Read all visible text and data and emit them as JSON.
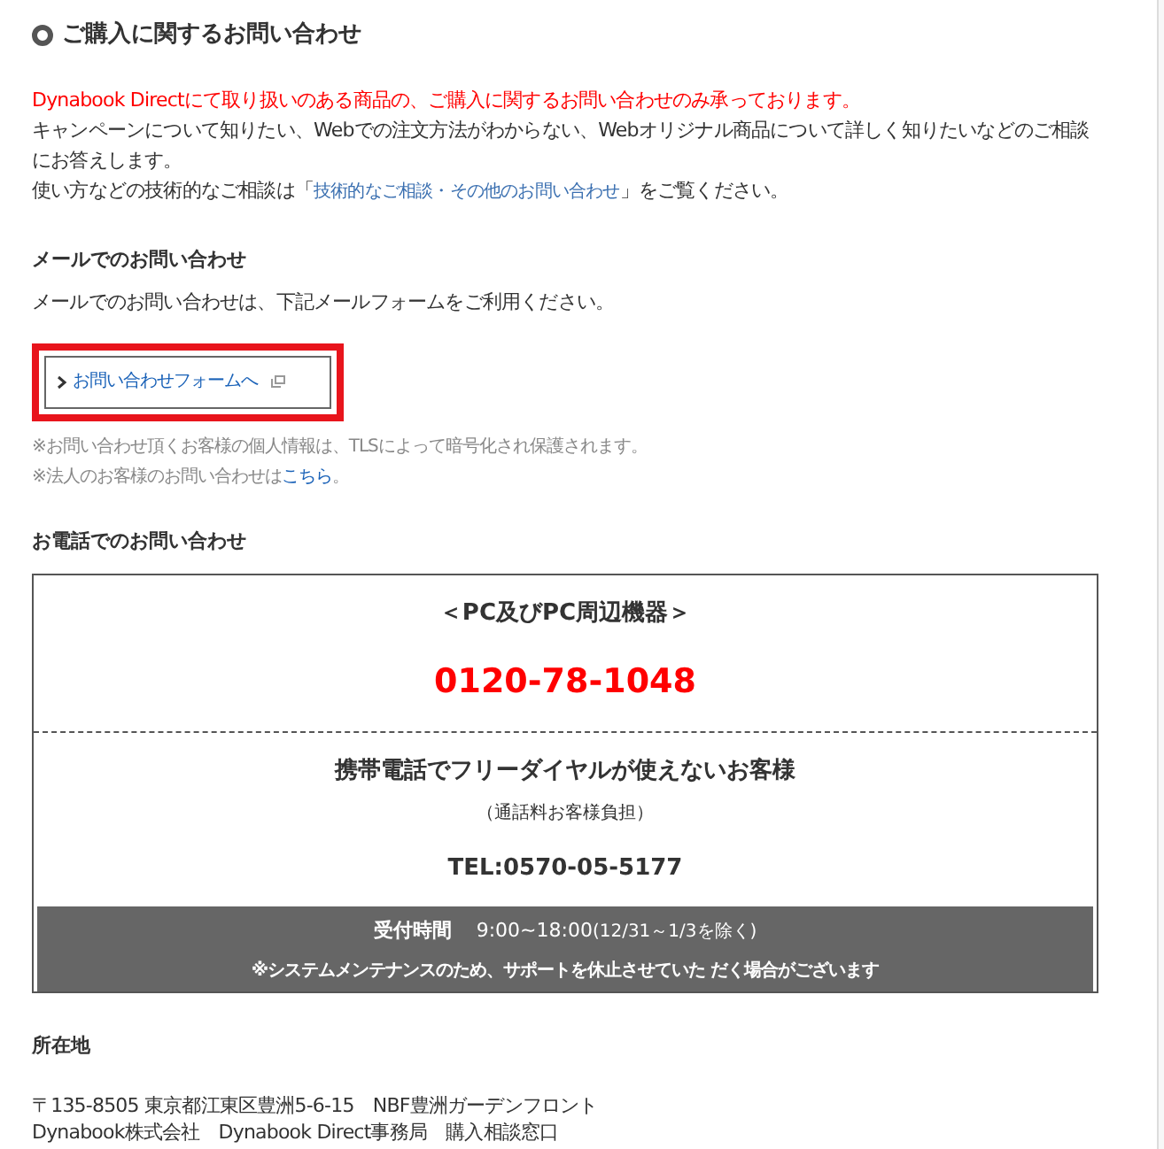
{
  "heading": "ご購入に関するお問い合わせ",
  "notice": "Dynabook Directにて取り扱いのある商品の、ご購入に関するお問い合わせのみ承っております。",
  "intro": "キャンペーンについて知りたい、Webでの注文方法がわからない、Webオリジナル商品について詳しく知りたいなどのご相談にお答えします。",
  "tech": {
    "before": "使い方などの技術的なご相談は「",
    "link": "技術的なご相談・その他のお問い合わせ",
    "after": "」をご覧ください。"
  },
  "mail": {
    "title": "メールでのお問い合わせ",
    "text": "メールでのお問い合わせは、下記メールフォームをご利用ください。",
    "button": "お問い合わせフォームへ",
    "highlighted": true
  },
  "notes": [
    {
      "before": "※お問い合わせ頂くお客様の個人情報は、TLSによって暗号化され保護されます。"
    },
    {
      "before": "※法人のお客様のお問い合わせは",
      "link": "こちら",
      "after": "。"
    }
  ],
  "phone": {
    "title": "お電話でのお問い合わせ",
    "category": "＜PC及びPC周辺機器＞",
    "free_dial": "0120-78-1048",
    "mobile_title": "携帯電話でフリーダイヤルが使えないお客様",
    "mobile_note": "（通話料お客様負担）",
    "tel": "TEL:0570-05-5177",
    "hours_label": "受付時間",
    "hours": "9:00~18:00",
    "hours_note": "(12/31～1/3を除く)",
    "maintenance": "※システムメンテナンスのため、サポートを休止させていた だく場合がございます"
  },
  "address": {
    "title": "所在地",
    "lines": [
      "〒135-8505 東京都江東区豊洲5-6-15　NBF豊洲ガーデンフロント",
      "Dynabook株式会社　Dynabook Direct事務局　購入相談窓口"
    ]
  }
}
